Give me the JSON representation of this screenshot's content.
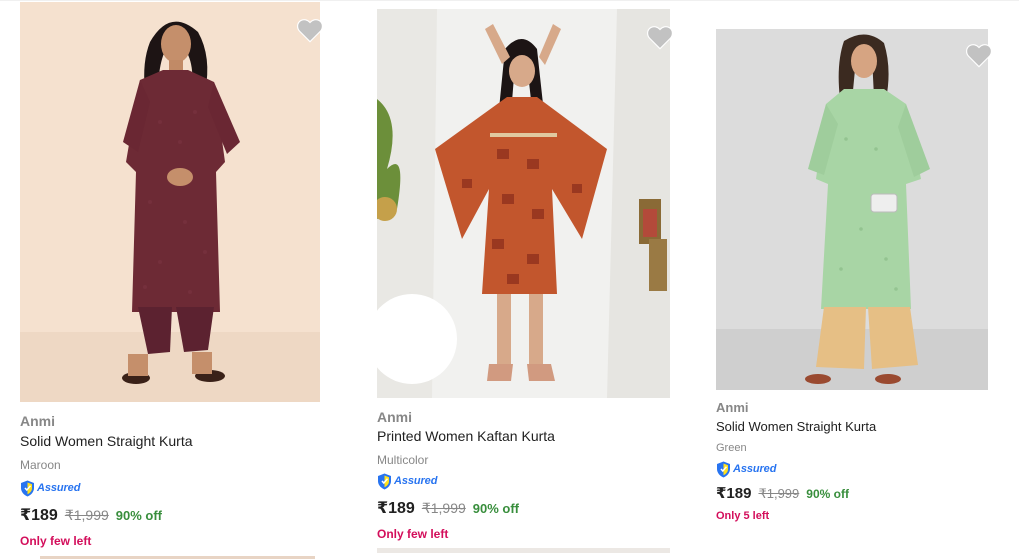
{
  "products": [
    {
      "brand": "Anmi",
      "title": "Solid Women Straight Kurta",
      "color": "Maroon",
      "assured_label": "Assured",
      "price": "₹189",
      "mrp": "₹1,999",
      "discount": "90% off",
      "stock": "Only few left",
      "wishlist_icon": "heart-icon"
    },
    {
      "brand": "Anmi",
      "title": "Printed Women Kaftan Kurta",
      "color": "Multicolor",
      "assured_label": "Assured",
      "price": "₹189",
      "mrp": "₹1,999",
      "discount": "90% off",
      "stock": "Only few left",
      "wishlist_icon": "heart-icon"
    },
    {
      "brand": "Anmi",
      "title": "Solid Women Straight Kurta",
      "color": "Green",
      "assured_label": "Assured",
      "price": "₹189",
      "mrp": "₹1,999",
      "discount": "90% off",
      "stock": "Only 5 left",
      "wishlist_icon": "heart-icon"
    }
  ],
  "colors": {
    "brand_grey": "#878787",
    "discount_green": "#388e3c",
    "stock_pink": "#ff3e6c",
    "assured_blue": "#2874f0",
    "heart_grey": "#c2c2c2"
  }
}
